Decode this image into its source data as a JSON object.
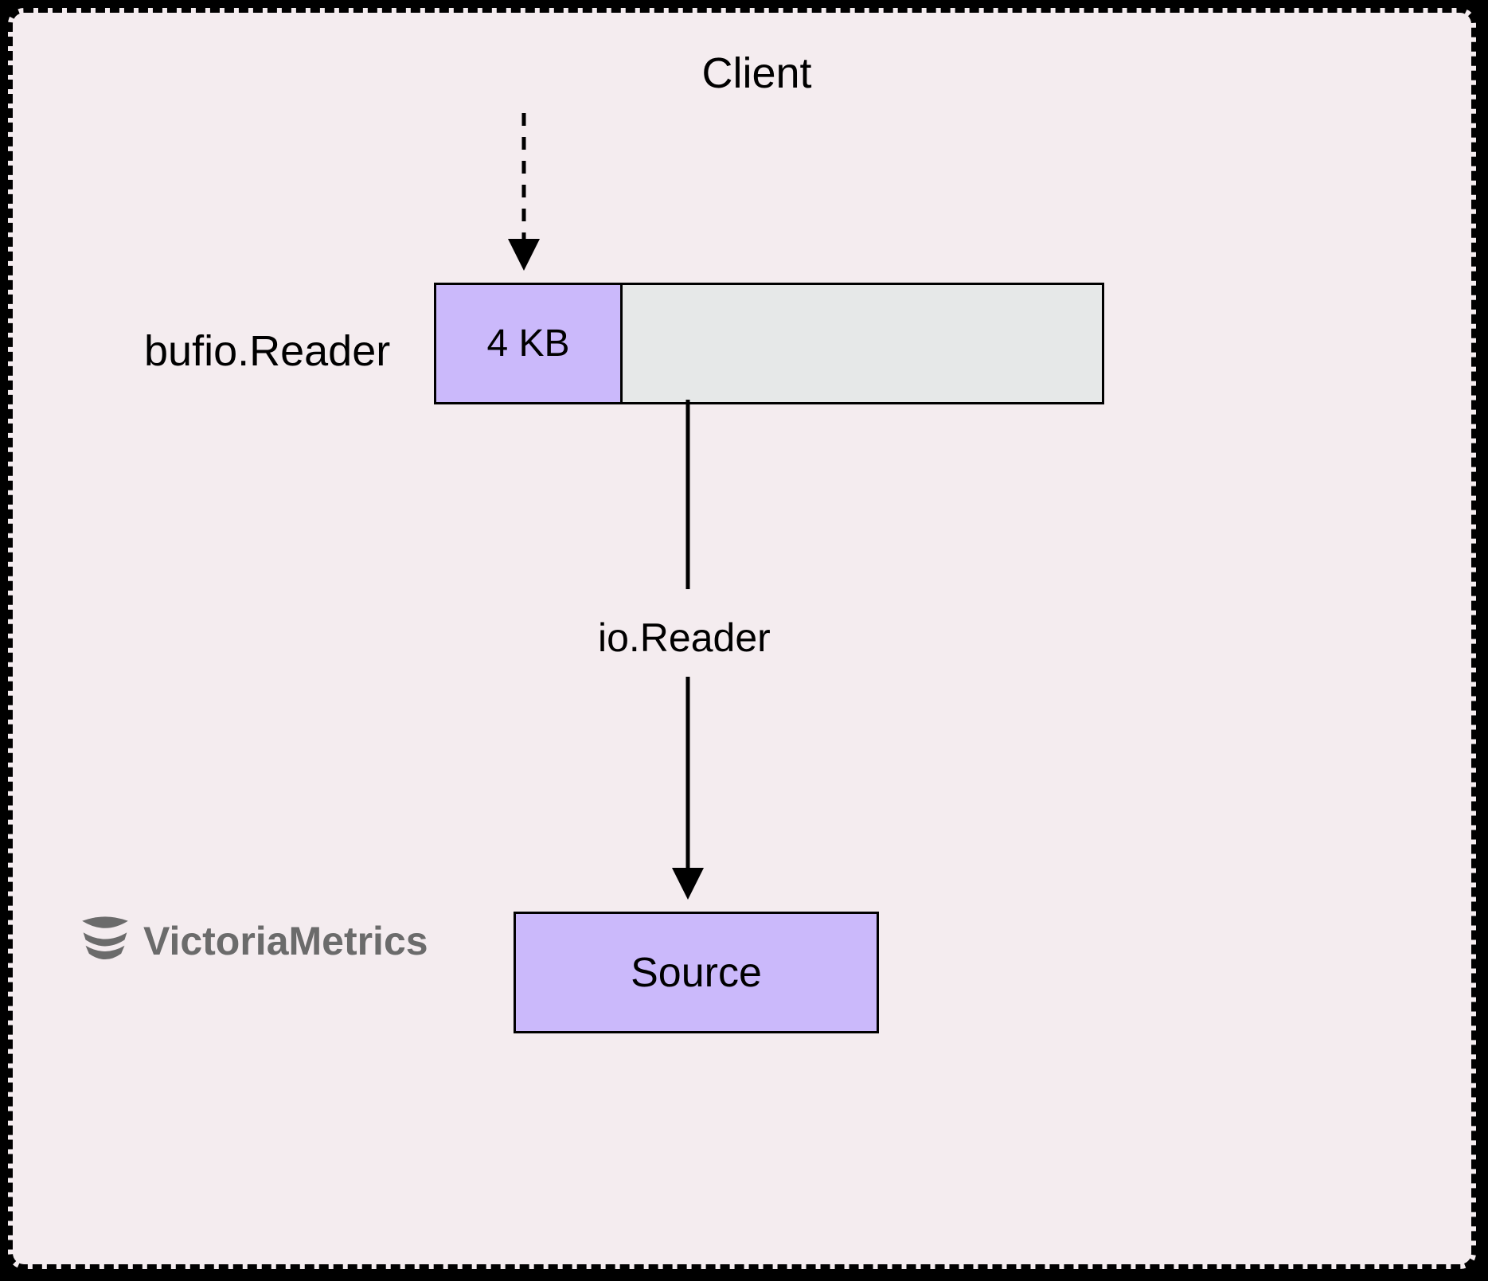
{
  "labels": {
    "client": "Client",
    "bufio_reader": "bufio.Reader",
    "io_reader": "io.Reader",
    "source": "Source",
    "buffer_size": "4 KB"
  },
  "logo": {
    "text": "VictoriaMetrics"
  },
  "colors": {
    "background": "#f4ecef",
    "border": "#000000",
    "fill_purple": "#cbb9fb",
    "fill_gray": "#e6e8e8",
    "logo_gray": "#6b6b6b"
  }
}
